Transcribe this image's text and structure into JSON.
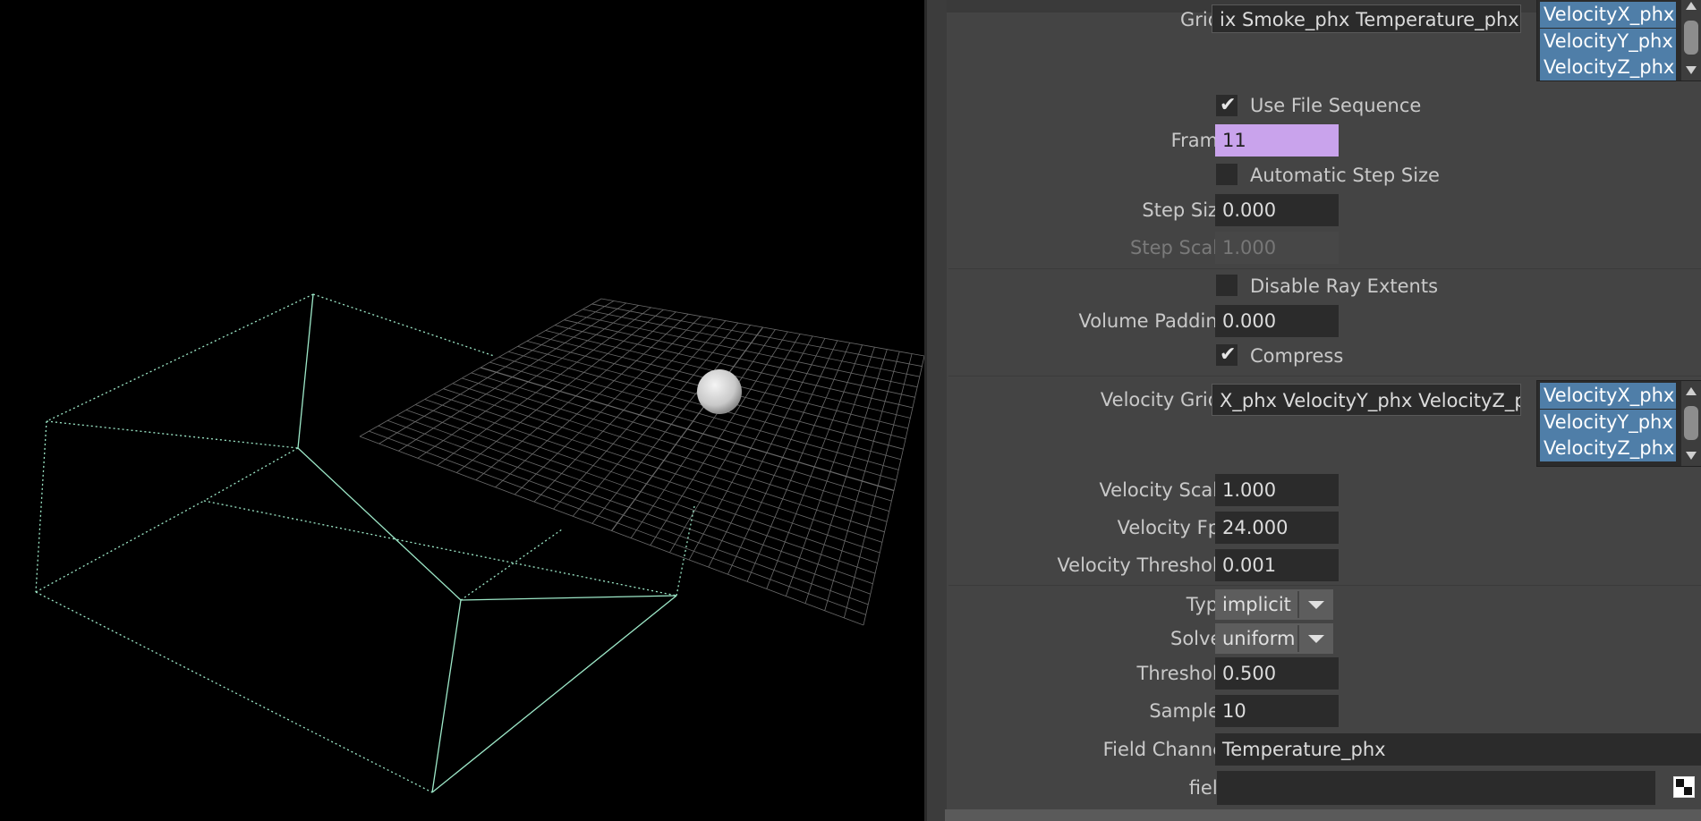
{
  "viewport": {
    "name": "3D viewport",
    "colors": {
      "background": "#000000",
      "wireframe": "#9de8c8",
      "grid": "#6a6a6a",
      "sphere": "#d8d8d8"
    }
  },
  "panel": {
    "grids": {
      "label": "Grids",
      "value": "ix Smoke_phx Temperature_phx Ve",
      "list": [
        "VelocityX_phx",
        "VelocityY_phx",
        "VelocityZ_phx"
      ]
    },
    "use_file_sequence": {
      "label": "Use File Sequence",
      "checked": true
    },
    "frame": {
      "label": "Frame",
      "value": "11"
    },
    "automatic_step_size": {
      "label": "Automatic Step Size",
      "checked": false
    },
    "step_size": {
      "label": "Step Size",
      "value": "0.000"
    },
    "step_scale": {
      "label": "Step Scale",
      "value": "1.000"
    },
    "disable_ray_extents": {
      "label": "Disable Ray Extents",
      "checked": false
    },
    "volume_padding": {
      "label": "Volume Padding",
      "value": "0.000"
    },
    "compress": {
      "label": "Compress",
      "checked": true
    },
    "velocity_grids": {
      "label": "Velocity Grids",
      "value": "X_phx VelocityY_phx VelocityZ_phx",
      "list": [
        "VelocityX_phx",
        "VelocityY_phx",
        "VelocityZ_phx"
      ]
    },
    "velocity_scale": {
      "label": "Velocity Scale",
      "value": "1.000"
    },
    "velocity_fps": {
      "label": "Velocity Fps",
      "value": "24.000"
    },
    "velocity_threshold": {
      "label": "Velocity Threshold",
      "value": "0.001"
    },
    "type": {
      "label": "Type",
      "value": "implicit"
    },
    "solver": {
      "label": "Solver",
      "value": "uniform"
    },
    "threshold": {
      "label": "Threshold",
      "value": "0.500"
    },
    "samples": {
      "label": "Samples",
      "value": "10"
    },
    "field_channel": {
      "label": "Field Channel",
      "value": "Temperature_phx"
    },
    "field": {
      "label": "field",
      "value": ""
    },
    "check_glyph": "✔",
    "colors": {
      "panel_bg": "#444444",
      "field_bg": "#2b2b2b",
      "keyed": "#c9a3ec",
      "selection": "#4f7ea8"
    }
  }
}
